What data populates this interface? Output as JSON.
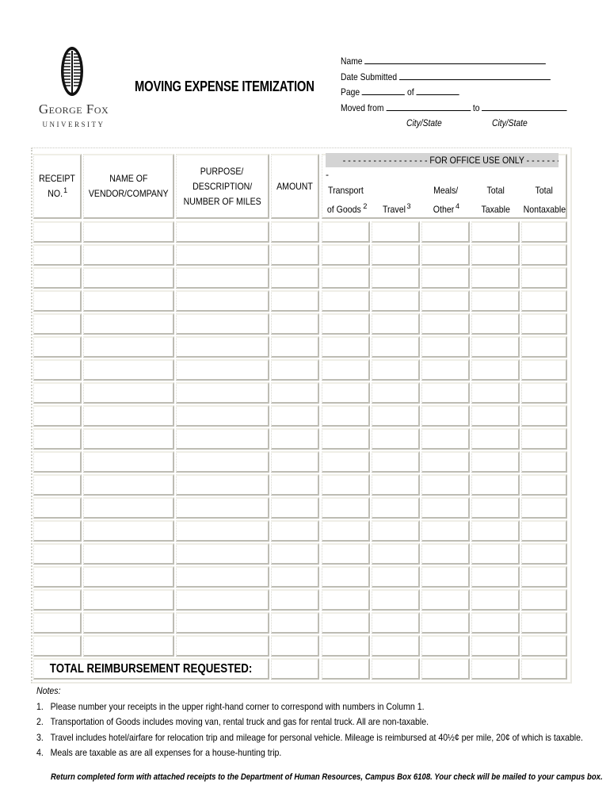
{
  "logo": {
    "name": "George Fox",
    "subtitle": "UNIVERSITY"
  },
  "title": "MOVING EXPENSE ITEMIZATION",
  "header_fields": {
    "name_label": "Name",
    "date_label": "Date Submitted",
    "page_label": "Page",
    "of_label": "of",
    "moved_from_label": "Moved from",
    "to_label": "to",
    "from_caption": "City/State",
    "to_caption": "City/State",
    "name_value": "",
    "date_value": "",
    "page_value": "",
    "page_total_value": "",
    "moved_from_value": "",
    "moved_to_value": ""
  },
  "table": {
    "columns": [
      {
        "line1": "RECEIPT",
        "line2": "NO.",
        "sup": "1"
      },
      {
        "line1": "NAME OF",
        "line2": "VENDOR/COMPANY"
      },
      {
        "line1": "PURPOSE/",
        "line2": "DESCRIPTION/",
        "line3": "NUMBER OF MILES"
      },
      {
        "line1": "AMOUNT"
      }
    ],
    "office_use_label": "- - - - - - - - - - - - - - - - - FOR OFFICE USE ONLY - - - - - - - - - - - - - -",
    "office_use_trailing_dash": "-",
    "office_columns": [
      {
        "line1": "Transport",
        "line2": "of Goods",
        "sup": "2"
      },
      {
        "line1": "",
        "line2": "Travel ",
        "sup": "3"
      },
      {
        "line1": "Meals/",
        "line2": "Other",
        "sup": "4"
      },
      {
        "line1": "Total",
        "line2": "Taxable"
      },
      {
        "line1": "Total",
        "line2": "Nontaxable"
      }
    ],
    "row_count": 19,
    "rows": [],
    "total_label": "TOTAL REIMBURSEMENT REQUESTED:"
  },
  "notes": {
    "heading": "Notes:",
    "items": [
      {
        "num": "1.",
        "text": "Please number your receipts in the upper right-hand corner to correspond with numbers in Column 1."
      },
      {
        "num": "2.",
        "text": "Transportation of Goods includes moving van, rental truck and gas for rental truck.  All are non-taxable."
      },
      {
        "num": "3.",
        "text": "Travel includes hotel/airfare for relocation trip and mileage for personal vehicle.  Mileage is reimbursed at 40½¢ per mile, 20¢ of which is taxable."
      },
      {
        "num": "4.",
        "text": "Meals are taxable as are all expenses for a house-hunting trip."
      }
    ]
  },
  "footer": "Return completed form with attached receipts to the Department of Human Resources, Campus Box 6108.  Your check will be mailed to your campus box.",
  "colors": {
    "office_bar": "#d4d4d4",
    "cell_shadow": "#bdbcb3",
    "cell_highlight": "#efeee6"
  }
}
